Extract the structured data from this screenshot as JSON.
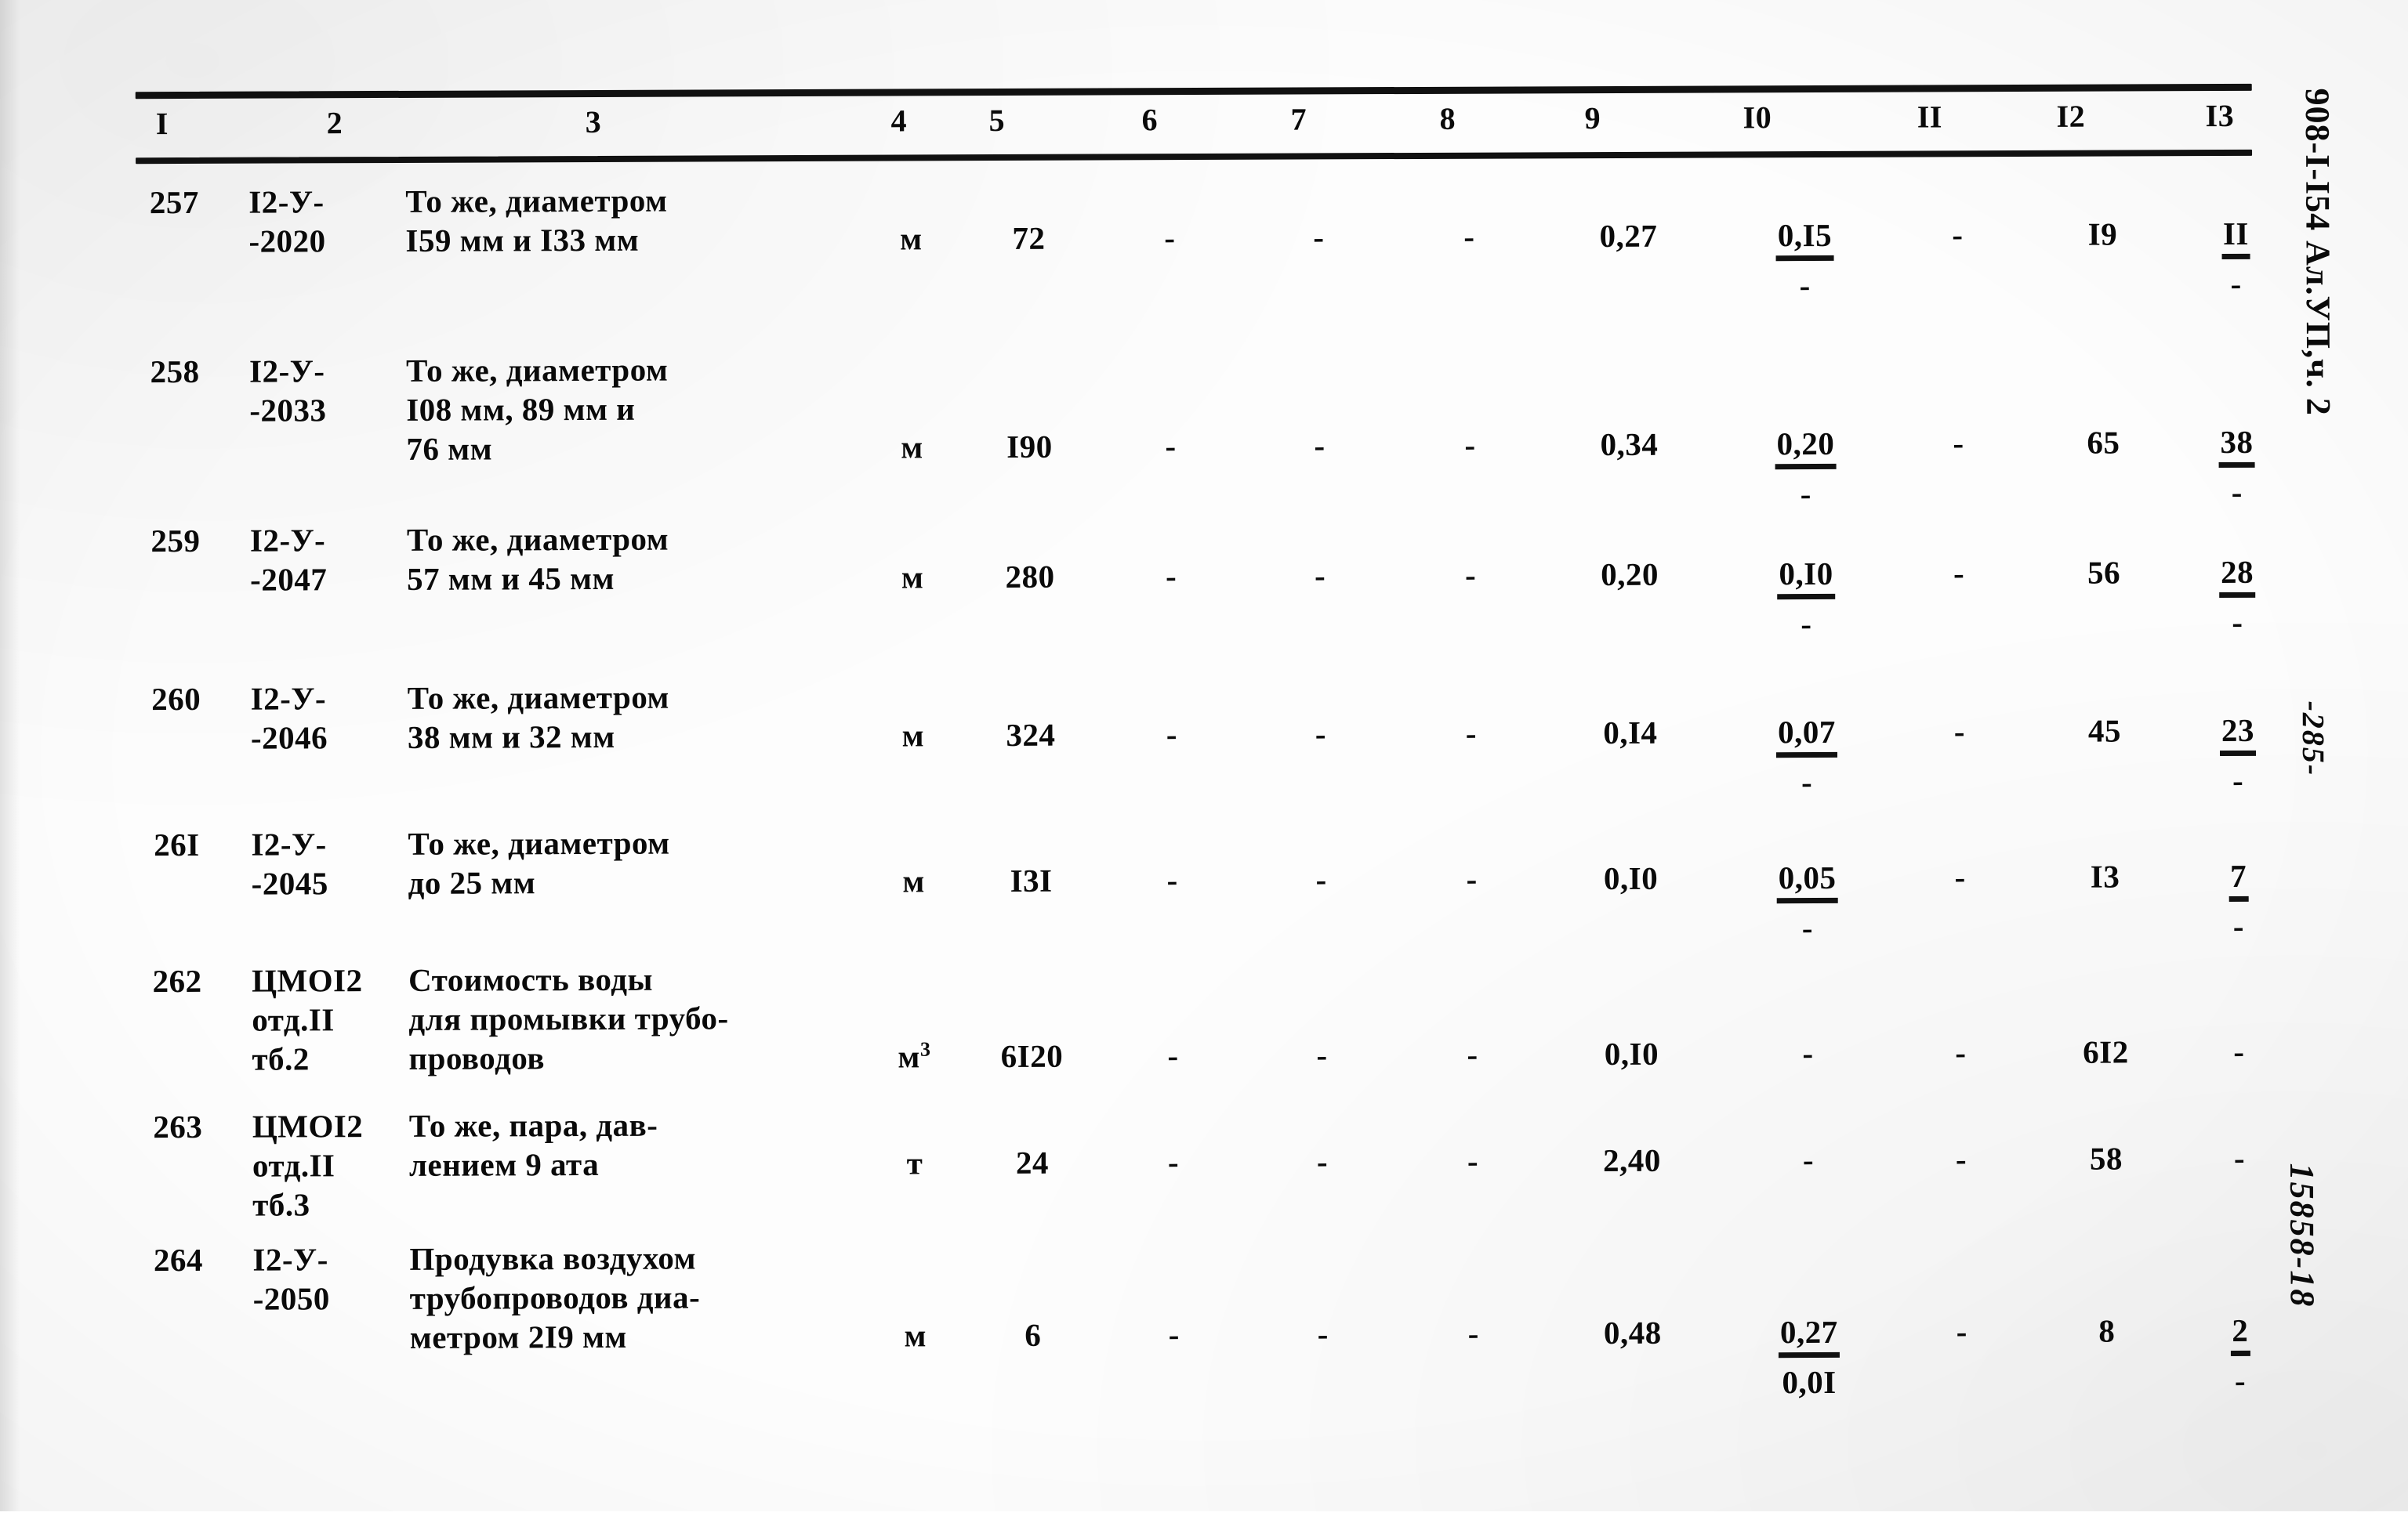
{
  "document": {
    "margin_code": "908-I-I54 Ал.УП,ч. 2",
    "page_number": "-285-",
    "archive_stamp": "15858-18"
  },
  "table": {
    "column_headers": [
      "I",
      "2",
      "3",
      "4",
      "5",
      "6",
      "7",
      "8",
      "9",
      "I0",
      "II",
      "I2",
      "I3"
    ],
    "rows": [
      {
        "n": "257",
        "code": [
          "I2-У-",
          "-2020"
        ],
        "desc": [
          "То же, диаметром",
          "I59 мм и I33 мм"
        ],
        "unit": "м",
        "qty": "72",
        "c6": "-",
        "c7": "-",
        "c8": "-",
        "c9": "0,27",
        "c10_num": "0,I5",
        "c10_den": "-",
        "c11": "-",
        "c12": "I9",
        "c13_num": "II",
        "c13_den": "-"
      },
      {
        "n": "258",
        "code": [
          "I2-У-",
          "-2033"
        ],
        "desc": [
          "То же, диаметром",
          "I08 мм, 89 мм и",
          "76 мм"
        ],
        "unit": "м",
        "qty": "I90",
        "c6": "-",
        "c7": "-",
        "c8": "-",
        "c9": "0,34",
        "c10_num": "0,20",
        "c10_den": "-",
        "c11": "-",
        "c12": "65",
        "c13_num": "38",
        "c13_den": "-"
      },
      {
        "n": "259",
        "code": [
          "I2-У-",
          "-2047"
        ],
        "desc": [
          "То же, диаметром",
          "57 мм и 45 мм"
        ],
        "unit": "м",
        "qty": "280",
        "c6": "-",
        "c7": "-",
        "c8": "-",
        "c9": "0,20",
        "c10_num": "0,I0",
        "c10_den": "-",
        "c11": "-",
        "c12": "56",
        "c13_num": "28",
        "c13_den": "-"
      },
      {
        "n": "260",
        "code": [
          "I2-У-",
          "-2046"
        ],
        "desc": [
          "То же, диаметром",
          "38 мм и 32 мм"
        ],
        "unit": "м",
        "qty": "324",
        "c6": "-",
        "c7": "-",
        "c8": "-",
        "c9": "0,I4",
        "c10_num": "0,07",
        "c10_den": "-",
        "c11": "-",
        "c12": "45",
        "c13_num": "23",
        "c13_den": "-"
      },
      {
        "n": "26I",
        "code": [
          "I2-У-",
          "-2045"
        ],
        "desc": [
          "То же, диаметром",
          "до 25 мм"
        ],
        "unit": "м",
        "qty": "I3I",
        "c6": "-",
        "c7": "-",
        "c8": "-",
        "c9": "0,I0",
        "c10_num": "0,05",
        "c10_den": "-",
        "c11": "-",
        "c12": "I3",
        "c13_num": "7",
        "c13_den": "-"
      },
      {
        "n": "262",
        "code": [
          "ЦМОI2",
          "отд.II",
          "тб.2"
        ],
        "desc": [
          "Стоимость воды",
          "для промывки трубо-",
          "проводов"
        ],
        "unit": "м3",
        "unit_base": "м",
        "unit_sup": "3",
        "qty": "6I20",
        "c6": "-",
        "c7": "-",
        "c8": "-",
        "c9": "0,I0",
        "c10_num": "-",
        "c10_den": "",
        "c11": "-",
        "c12": "6I2",
        "c13_num": "-",
        "c13_den": ""
      },
      {
        "n": "263",
        "code": [
          "ЦМОI2",
          "отд.II",
          "тб.3"
        ],
        "desc": [
          "То же, пара, дав-",
          "лением 9 ата"
        ],
        "unit": "т",
        "qty": "24",
        "c6": "-",
        "c7": "-",
        "c8": "-",
        "c9": "2,40",
        "c10_num": "-",
        "c10_den": "",
        "c11": "-",
        "c12": "58",
        "c13_num": "-",
        "c13_den": ""
      },
      {
        "n": "264",
        "code": [
          "I2-У-",
          "-2050"
        ],
        "desc": [
          "Продувка воздухом",
          "трубопроводов диа-",
          "метром 2I9 мм"
        ],
        "unit": "м",
        "qty": "6",
        "c6": "-",
        "c7": "-",
        "c8": "-",
        "c9": "0,48",
        "c10_num": "0,27",
        "c10_den": "0,0I",
        "c11": "-",
        "c12": "8",
        "c13_num": "2",
        "c13_den": "-"
      }
    ]
  }
}
